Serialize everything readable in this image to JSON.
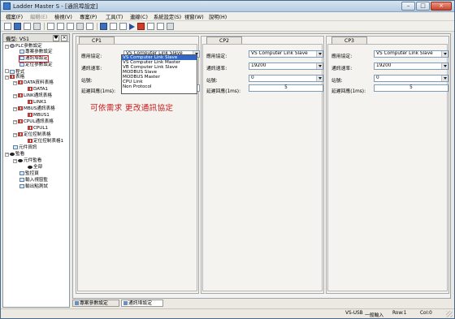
{
  "window": {
    "title": "Ladder Master S - [通訊埠設定]",
    "min": "–",
    "max": "□",
    "close": "×"
  },
  "menu": [
    {
      "label": "檔案(F)",
      "enabled": true
    },
    {
      "label": "編輯(E)",
      "enabled": false
    },
    {
      "label": "檢視(V)",
      "enabled": true
    },
    {
      "label": "專案(P)",
      "enabled": true
    },
    {
      "label": "工具(T)",
      "enabled": true
    },
    {
      "label": "連線(C)",
      "enabled": true
    },
    {
      "label": "系統設定(S)",
      "enabled": true
    },
    {
      "label": "視窗(W)",
      "enabled": true
    },
    {
      "label": "說明(H)",
      "enabled": true
    }
  ],
  "sidebar": {
    "title": "機型: VS1",
    "pin": "♥",
    "close": "×",
    "tree": [
      {
        "label": "PLC參數設定",
        "toggle": "−",
        "icon": "gear"
      },
      {
        "label": "專案參數設定",
        "icon": "doc"
      },
      {
        "label": "通訊埠設定",
        "icon": "port",
        "selected": true
      },
      {
        "label": "定位參數設定",
        "icon": "doc"
      },
      {
        "label": "程式",
        "toggle": "",
        "icon": "doc"
      },
      {
        "label": "表格",
        "toggle": "−",
        "icon": "grid"
      },
      {
        "label": "DATA資料表格",
        "toggle": "−",
        "icon": "grid"
      },
      {
        "label": "DATA1",
        "icon": "grid"
      },
      {
        "label": "LINK通訊表格",
        "toggle": "−",
        "icon": "grid"
      },
      {
        "label": "LINK1",
        "icon": "grid"
      },
      {
        "label": "MBUS通訊表格",
        "toggle": "−",
        "icon": "grid"
      },
      {
        "label": "MBUS1",
        "icon": "grid"
      },
      {
        "label": "CPUL通訊表格",
        "toggle": "−",
        "icon": "grid"
      },
      {
        "label": "CPUL1",
        "icon": "grid"
      },
      {
        "label": "定位控制表格",
        "toggle": "−",
        "icon": "grid"
      },
      {
        "label": "定位控制表格1",
        "icon": "grid"
      },
      {
        "label": "元件資訊",
        "icon": "doc"
      },
      {
        "label": "監看",
        "toggle": "−",
        "icon": "eye"
      },
      {
        "label": "元件監看",
        "toggle": "−",
        "icon": "eye"
      },
      {
        "label": "全部",
        "icon": "eye"
      },
      {
        "label": "監控頁",
        "icon": "doc"
      },
      {
        "label": "輸入視窗監",
        "icon": "doc"
      },
      {
        "label": "輸出點測試",
        "icon": "doc"
      }
    ]
  },
  "form_labels": {
    "protocol": "應用協定:",
    "baud": "通訊速率:",
    "station": "站號:",
    "delay": "延遲回應(1ms):"
  },
  "panels": [
    {
      "tab": "CP1",
      "protocol": "VS Computer Link Slave",
      "baud": "",
      "station": "",
      "delay": "5"
    },
    {
      "tab": "CP2",
      "protocol": "VS Computer Link Slave",
      "baud": "19200",
      "station": "0",
      "delay": "5"
    },
    {
      "tab": "CP3",
      "protocol": "VS Computer Link Slave",
      "baud": "19200",
      "station": "0",
      "delay": "5"
    }
  ],
  "dropdown_options": [
    "VS Computer Link Slave",
    "VS Computer Link Master",
    "VB Computer Link Slave",
    "MODBUS Slave",
    "MODBUS Master",
    "CPU Link",
    "Non Protocol"
  ],
  "annotation": "可依需求 更改通訊協定",
  "bottom_tabs": [
    {
      "label": "專案參數設定",
      "active": false
    },
    {
      "label": "通訊埠設定",
      "active": true
    }
  ],
  "status": {
    "conn": "VS-USB",
    "mode": "一般輸入",
    "row": "Row:1",
    "col": "Col:0"
  }
}
